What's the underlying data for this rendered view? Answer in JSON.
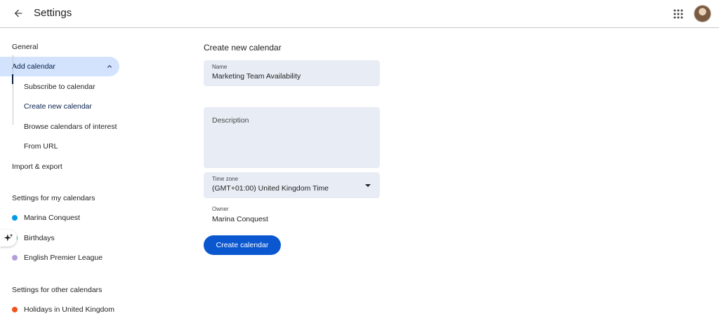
{
  "header": {
    "title": "Settings"
  },
  "sidebar": {
    "general": "General",
    "add_calendar": "Add calendar",
    "sub_items": [
      "Subscribe to calendar",
      "Create new calendar",
      "Browse calendars of interest",
      "From URL"
    ],
    "import_export": "Import & export",
    "my_calendars_heading": "Settings for my calendars",
    "my_calendars": [
      {
        "name": "Marina Conquest",
        "color": "#039be5"
      },
      {
        "name": "Birthdays",
        "color": "#33b679"
      },
      {
        "name": "English Premier League",
        "color": "#b39ddb"
      }
    ],
    "other_calendars_heading": "Settings for other calendars",
    "other_calendars": [
      {
        "name": "Holidays in United Kingdom",
        "color": "#f4511e"
      }
    ]
  },
  "main": {
    "heading": "Create new calendar",
    "name_label": "Name",
    "name_value": "Marketing Team Availability",
    "description_label": "Description",
    "timezone_label": "Time zone",
    "timezone_value": "(GMT+01:00) United Kingdom Time",
    "owner_label": "Owner",
    "owner_value": "Marina Conquest",
    "create_button": "Create calendar"
  },
  "colors": {
    "accent": "#0b57d0",
    "active_bg": "#d3e3fd",
    "field_bg": "#e8edf5"
  }
}
